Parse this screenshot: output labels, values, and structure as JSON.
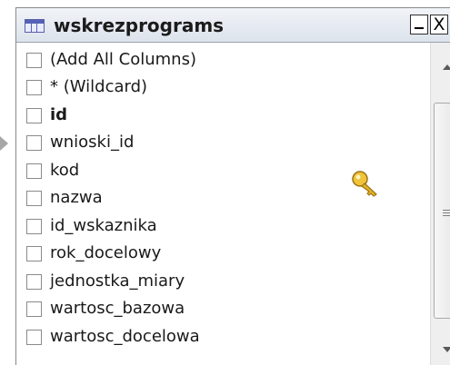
{
  "table": {
    "name": "wskrezprograms",
    "minimize_label": "_",
    "close_label": "X",
    "columns": [
      {
        "label": "(Add All Columns)",
        "bold": false
      },
      {
        "label": "* (Wildcard)",
        "bold": false
      },
      {
        "label": "id",
        "bold": true,
        "primary_key": true
      },
      {
        "label": "wnioski_id",
        "bold": false
      },
      {
        "label": "kod",
        "bold": false
      },
      {
        "label": "nazwa",
        "bold": false
      },
      {
        "label": "id_wskaznika",
        "bold": false
      },
      {
        "label": "rok_docelowy",
        "bold": false
      },
      {
        "label": "jednostka_miary",
        "bold": false
      },
      {
        "label": "wartosc_bazowa",
        "bold": false
      },
      {
        "label": "wartosc_docelowa",
        "bold": false
      }
    ]
  },
  "icons": {
    "table": "table-icon",
    "primary_key": "key-icon",
    "row_indicator": "row-indicator-arrow-icon"
  },
  "colors": {
    "titlebar_top": "#f1f4f8",
    "titlebar_bottom": "#dde3ec",
    "key_gold": "#e3b526",
    "table_icon_blue": "#5361b8"
  }
}
